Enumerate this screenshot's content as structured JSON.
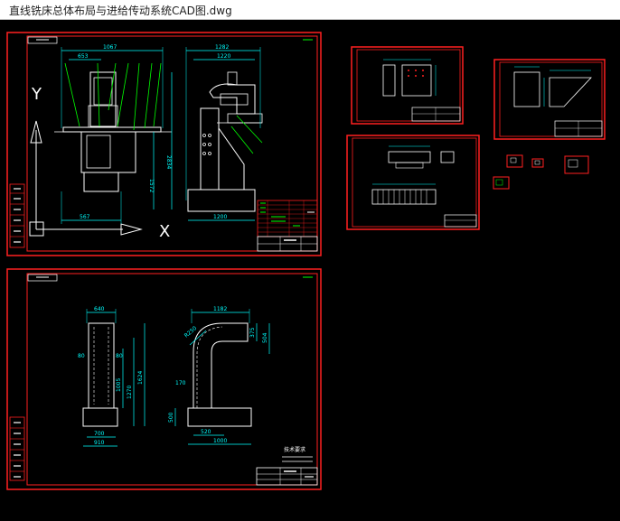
{
  "window": {
    "title": "直线铣床总体布局与进给传动系统CAD图.dwg"
  },
  "drawing": {
    "colors": {
      "background": "#000000",
      "border": "#ff0000",
      "dimension": "#00ffff",
      "geometry": "#ffffff",
      "leader": "#00ff00"
    },
    "sheet1": {
      "front_width": "1067",
      "front_sub": "653",
      "front_height": "2834",
      "front_mid": "1572",
      "front_base": "567",
      "side_width": "1282",
      "side_sub": "1220",
      "side_base": "1200",
      "axis_y": "Y",
      "axis_x": "X"
    },
    "sheet2": {
      "col_width": "640",
      "col_mid": "80",
      "col_h1": "1005",
      "col_h2": "1270",
      "col_h3": "1624",
      "col_base1": "700",
      "col_base2": "910",
      "side_top": "1182",
      "side_r": "R250",
      "side_notch": "375",
      "side_notch2": "504",
      "side_left": "170",
      "side_foot": "500",
      "side_base1": "520",
      "side_base2": "1000",
      "note_title": "技术要求"
    }
  }
}
